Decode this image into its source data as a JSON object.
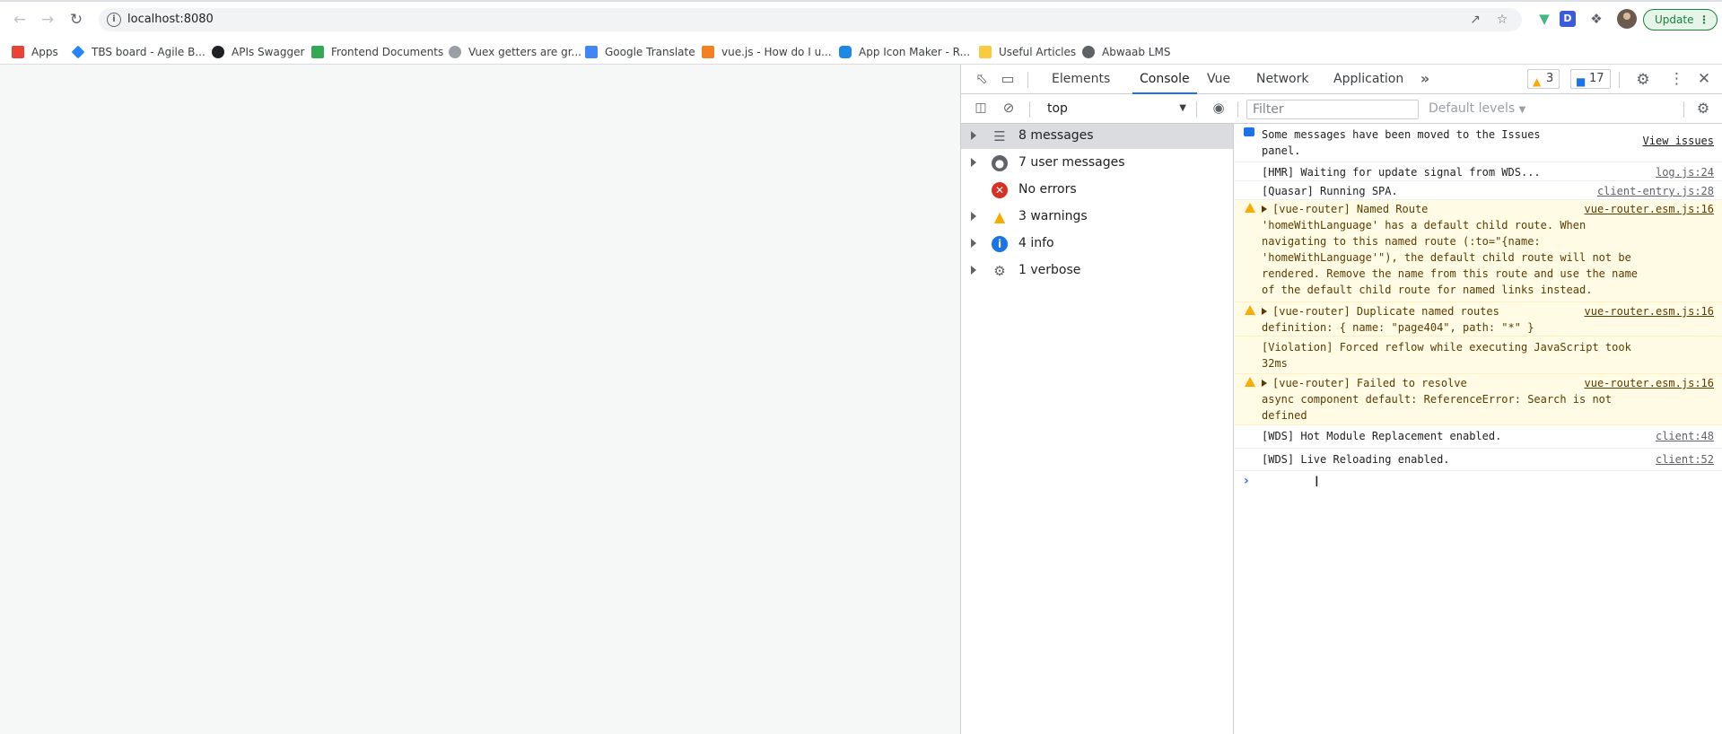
{
  "browser": {
    "url": "localhost:8080",
    "update_label": "Update",
    "bookmarks": [
      {
        "label": "Apps",
        "icon": "apps-grid-icon",
        "color": "#ea4335"
      },
      {
        "label": "TBS board - Agile B...",
        "icon": "jira-icon",
        "color": "#2684ff"
      },
      {
        "label": "APIs Swagger",
        "icon": "swagger-icon",
        "color": "#202124"
      },
      {
        "label": "Frontend Documents",
        "icon": "google-drive-icon",
        "color": "#34a853"
      },
      {
        "label": "Vuex getters are gr...",
        "icon": "vuex-icon",
        "color": "#9aa0a6"
      },
      {
        "label": "Google Translate",
        "icon": "google-translate-icon",
        "color": "#4285f4"
      },
      {
        "label": "vue.js - How do I u...",
        "icon": "stackoverflow-icon",
        "color": "#f48024"
      },
      {
        "label": "App Icon Maker - R...",
        "icon": "app-icon-maker-icon",
        "color": "#1e88e5"
      },
      {
        "label": "Useful Articles",
        "icon": "folder-icon",
        "color": "#f9cb40"
      },
      {
        "label": "Abwaab LMS",
        "icon": "globe-icon",
        "color": "#5f6368"
      }
    ]
  },
  "devtools": {
    "tabs": [
      "Elements",
      "Console",
      "Vue",
      "Network",
      "Application"
    ],
    "active_tab": "Console",
    "warnings_count": "3",
    "messages_count": "17",
    "context": "top",
    "filter_placeholder": "Filter",
    "levels_label": "Default levels",
    "sidebar": [
      {
        "label": "8 messages",
        "icon": "list-icon",
        "expandable": true,
        "selected": true
      },
      {
        "label": "7 user messages",
        "icon": "user-icon",
        "expandable": true,
        "selected": false
      },
      {
        "label": "No errors",
        "icon": "error-icon",
        "expandable": false,
        "selected": false
      },
      {
        "label": "3 warnings",
        "icon": "warning-icon",
        "expandable": true,
        "selected": false
      },
      {
        "label": "4 info",
        "icon": "info-icon",
        "expandable": true,
        "selected": false
      },
      {
        "label": "1 verbose",
        "icon": "bug-icon",
        "expandable": true,
        "selected": false
      }
    ],
    "console_messages": [
      {
        "type": "issue",
        "text": "Some messages have been moved to the Issues\npanel.",
        "source": "View issues"
      },
      {
        "type": "log",
        "text": "[HMR] Waiting for update signal from WDS...",
        "source": "log.js:24"
      },
      {
        "type": "log",
        "text": "[Quasar] Running SPA.",
        "source": "client-entry.js:28"
      },
      {
        "type": "warn",
        "text": "[vue-router] Named Route\n'homeWithLanguage' has a default child route. When\nnavigating to this named route (:to=\"{name:\n'homeWithLanguage'\"), the default child route will not be\nrendered. Remove the name from this route and use the name\nof the default child route for named links instead.",
        "source": "vue-router.esm.js:16"
      },
      {
        "type": "warn",
        "text": "[vue-router] Duplicate named routes\ndefinition: { name: \"page404\", path: \"*\" }",
        "source": "vue-router.esm.js:16"
      },
      {
        "type": "violation",
        "text": "[Violation] Forced reflow while executing JavaScript took\n32ms",
        "source": ""
      },
      {
        "type": "warn",
        "text": "[vue-router] Failed to resolve\nasync component default: ReferenceError: Search is not\ndefined",
        "source": "vue-router.esm.js:16"
      },
      {
        "type": "log",
        "text": "[WDS] Hot Module Replacement enabled.",
        "source": "client:48"
      },
      {
        "type": "log",
        "text": "[WDS] Live Reloading enabled.",
        "source": "client:52"
      }
    ]
  }
}
